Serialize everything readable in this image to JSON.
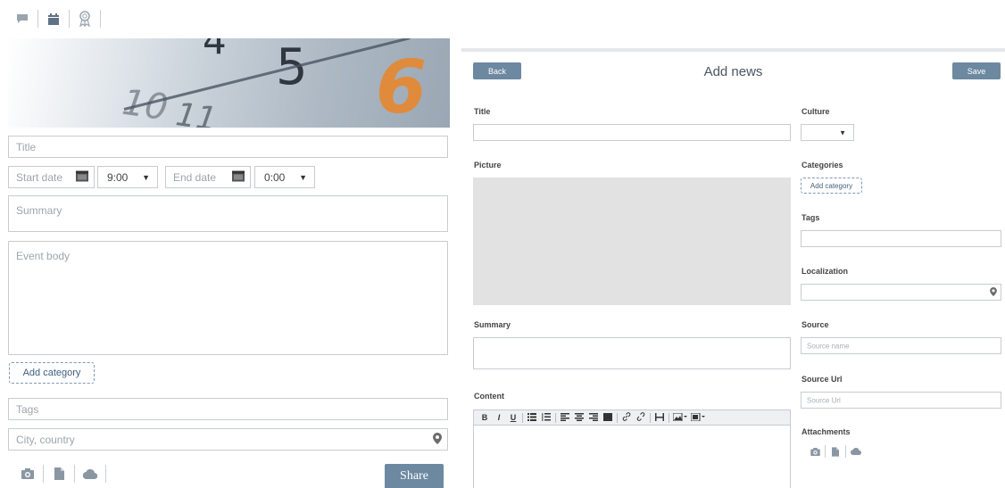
{
  "composer_tabs": [
    {
      "icon": "comment-icon"
    },
    {
      "icon": "calendar-icon"
    },
    {
      "icon": "award-icon"
    }
  ],
  "event_form": {
    "banner": {
      "numbers": [
        "10",
        "11",
        "4",
        "5",
        "6"
      ]
    },
    "title_placeholder": "Title",
    "start_date_placeholder": "Start date",
    "start_time": "9:00",
    "end_date_placeholder": "End date",
    "end_time": "0:00",
    "summary_placeholder": "Summary",
    "body_placeholder": "Event body",
    "add_category_label": "Add category",
    "tags_placeholder": "Tags",
    "location_placeholder": "City, country",
    "attach_icons": [
      "camera-icon",
      "document-icon",
      "cloud-icon"
    ],
    "share_label": "Share"
  },
  "add_news": {
    "back_label": "Back",
    "title": "Add news",
    "save_label": "Save",
    "labels": {
      "title": "Title",
      "picture": "Picture",
      "summary": "Summary",
      "content": "Content",
      "culture": "Culture",
      "categories": "Categories",
      "tags": "Tags",
      "localization": "Localization",
      "source": "Source",
      "source_url": "Source Url",
      "attachments": "Attachments"
    },
    "add_category_label": "Add category",
    "source_name_placeholder": "Source name",
    "source_url_placeholder": "Source Url",
    "toolbar": [
      "B",
      "I",
      "U"
    ],
    "attach_icons": [
      "camera-icon",
      "document-icon",
      "cloud-icon"
    ]
  },
  "colors": {
    "accent": "#6d88a1",
    "banner_accent": "#e08a3c"
  }
}
